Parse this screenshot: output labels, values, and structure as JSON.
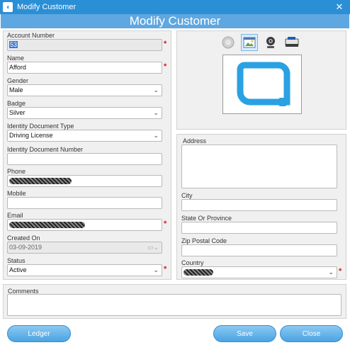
{
  "window": {
    "title": "Modify Customer",
    "close_glyph": "✕"
  },
  "banner": {
    "title": "Modify Customer"
  },
  "form": {
    "account_number": {
      "label": "Account Number",
      "value": "53"
    },
    "name": {
      "label": "Name",
      "value": "Afford"
    },
    "gender": {
      "label": "Gender",
      "value": "Male"
    },
    "badge": {
      "label": "Badge",
      "value": "Silver"
    },
    "id_doc_type": {
      "label": "Identity Document Type",
      "value": "Driving License"
    },
    "id_doc_number": {
      "label": "Identity Document Number",
      "value": ""
    },
    "phone": {
      "label": "Phone"
    },
    "mobile": {
      "label": "Mobile",
      "value": ""
    },
    "email": {
      "label": "Email"
    },
    "created_on": {
      "label": "Created On",
      "value": "03-09-2019"
    },
    "status": {
      "label": "Status",
      "value": "Active"
    },
    "required_mark": "*"
  },
  "address": {
    "address": {
      "label": "Address",
      "value": ""
    },
    "city": {
      "label": "City",
      "value": ""
    },
    "state": {
      "label": "State Or Province",
      "value": ""
    },
    "zip": {
      "label": "Zip Postal Code",
      "value": ""
    },
    "country": {
      "label": "Country"
    }
  },
  "comments": {
    "label": "Comments",
    "value": ""
  },
  "photo_toolbar": [
    "clear-photo-icon",
    "browse-image-icon",
    "webcam-icon",
    "scanner-icon"
  ],
  "buttons": {
    "ledger": "Ledger",
    "save": "Save",
    "close": "Close"
  },
  "colors": {
    "titlebar": "#2b8fd6",
    "banner": "#5fa7e0",
    "required": "#d11b1b",
    "logo": "#2aa1e3"
  }
}
